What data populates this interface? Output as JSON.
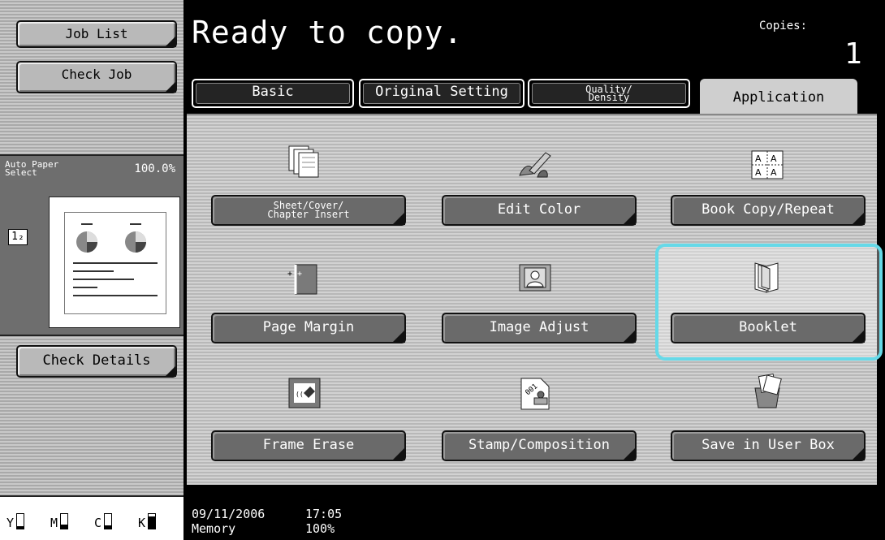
{
  "left_panel": {
    "job_list": "Job List",
    "check_job": "Check Job",
    "preview": {
      "label_line1": "Auto Paper",
      "label_line2": "Select",
      "zoom": "100.0%",
      "badge": "1₂"
    },
    "check_details": "Check Details",
    "toner": [
      {
        "letter": "Y",
        "level": 0.15
      },
      {
        "letter": "M",
        "level": 0.3
      },
      {
        "letter": "C",
        "level": 0.2
      },
      {
        "letter": "K",
        "level": 0.85
      }
    ]
  },
  "header": {
    "status": "Ready to copy.",
    "copies_label": "Copies:",
    "copies_value": "1"
  },
  "tabs": {
    "basic": "Basic",
    "original_setting": "Original Setting",
    "quality_line1": "Quality/",
    "quality_line2": "Density",
    "application": "Application"
  },
  "functions": {
    "sheet_line1": "Sheet/Cover/",
    "sheet_line2": "Chapter Insert",
    "edit_color": "Edit Color",
    "book_copy": "Book Copy/Repeat",
    "page_margin": "Page Margin",
    "image_adjust": "Image Adjust",
    "booklet": "Booklet",
    "frame_erase": "Frame Erase",
    "stamp": "Stamp/Composition",
    "save_user_box": "Save in User Box"
  },
  "footer": {
    "date": "09/11/2006",
    "time": "17:05",
    "memory_label": "Memory",
    "memory_value": "100%"
  },
  "colors": {
    "highlight": "#66d9e8",
    "button_gray": "#6a6a6a"
  }
}
